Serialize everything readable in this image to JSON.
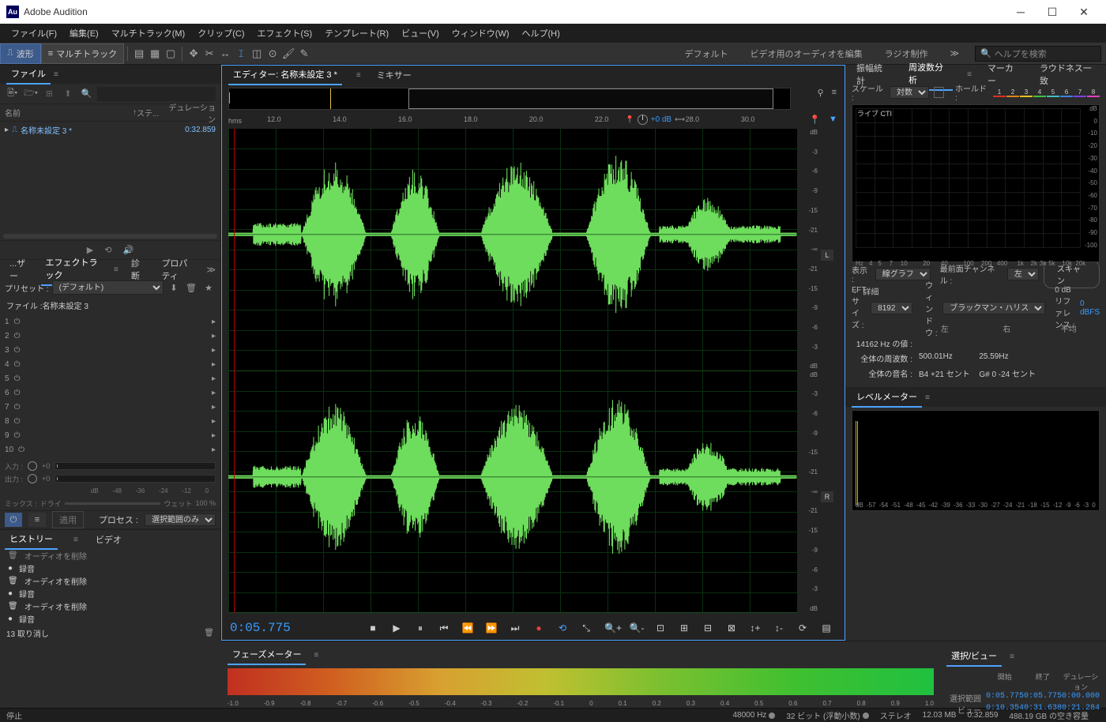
{
  "app": {
    "title": "Adobe Audition"
  },
  "menu": [
    "ファイル(F)",
    "編集(E)",
    "マルチトラック(M)",
    "クリップ(C)",
    "エフェクト(S)",
    "テンプレート(R)",
    "ビュー(V)",
    "ウィンドウ(W)",
    "ヘルプ(H)"
  ],
  "toolbar": {
    "waveform": "波形",
    "multitrack": "マルチトラック"
  },
  "workspaces": [
    "デフォルト",
    "ビデオ用のオーディオを編集",
    "ラジオ制作"
  ],
  "search_placeholder": "ヘルプを検索",
  "files": {
    "title": "ファイル",
    "cols": {
      "name": "名前",
      "status": "ステ...",
      "duration": "デュレーション"
    },
    "items": [
      {
        "name": "名称未設定 3 *",
        "duration": "0:32.859"
      }
    ]
  },
  "effects_rack": {
    "tabs": [
      "...ザー",
      "エフェクトラック",
      "診断",
      "プロパティ"
    ],
    "preset_label": "プリセット :",
    "preset_value": "(デフォルト)",
    "file_label": "ファイル :名称未設定 3",
    "slot_count": 10,
    "input_label": "入力 :",
    "output_label": "出力 :",
    "gain": "+0",
    "scale": [
      "dB",
      "-48",
      "-36",
      "-24",
      "-12",
      "0"
    ],
    "mix_label": "ミックス :",
    "dry": "ドライ",
    "wet": "ウェット",
    "wet_pct": "100 %",
    "apply": "適用",
    "process_label": "プロセス :",
    "process_value": "選択範囲のみ"
  },
  "history": {
    "tabs": [
      "ヒストリー",
      "ビデオ"
    ],
    "items": [
      {
        "label": "オーディオを削除",
        "icon": "trash",
        "dim": true
      },
      {
        "label": "録音",
        "icon": "rec"
      },
      {
        "label": "オーディオを削除",
        "icon": "trash"
      },
      {
        "label": "録音",
        "icon": "rec"
      },
      {
        "label": "オーディオを削除",
        "icon": "trash"
      },
      {
        "label": "録音",
        "icon": "rec"
      }
    ],
    "undo_count": "13 取り消し"
  },
  "editor": {
    "tabs": [
      "エディター: 名称未設定 3 *",
      "ミキサー"
    ],
    "timeline_unit": "hms",
    "timeline": [
      "12.0",
      "14.0",
      "16.0",
      "18.0",
      "20.0",
      "22.0",
      "28.0",
      "30.0"
    ],
    "volume_db": "+0 dB",
    "db_scale": [
      "dB",
      "-3",
      "-6",
      "-9",
      "-15",
      "-21",
      "-∞",
      "-21",
      "-15",
      "-9",
      "-6",
      "-3",
      "dB"
    ],
    "channels": [
      "L",
      "R"
    ],
    "timecode": "0:05.775"
  },
  "phase": {
    "title": "フェーズメーター",
    "scale": [
      "-1.0",
      "-0.9",
      "-0.8",
      "-0.7",
      "-0.6",
      "-0.5",
      "-0.4",
      "-0.3",
      "-0.2",
      "-0.1",
      "0",
      "0.1",
      "0.2",
      "0.3",
      "0.4",
      "0.5",
      "0.6",
      "0.7",
      "0.8",
      "0.9",
      "1.0"
    ]
  },
  "freq": {
    "tabs": [
      "振幅統計",
      "周波数分析",
      "マーカー",
      "ラウドネス一致"
    ],
    "scale_label": "スケール :",
    "scale_value": "対数",
    "hold_label": "ホールド :",
    "hold_colors": [
      "#e03020",
      "#e08020",
      "#e0c020",
      "#40c040",
      "#40c0c0",
      "#4080e0",
      "#8040e0",
      "#e040c0"
    ],
    "live": "ライブ CTI",
    "db_scale": [
      "dB",
      "0",
      "-10",
      "-20",
      "-30",
      "-40",
      "-50",
      "-60",
      "-70",
      "-80",
      "-90",
      "-100"
    ],
    "hz_scale": [
      {
        "v": "Hz",
        "p": 0
      },
      {
        "v": "4",
        "p": 6
      },
      {
        "v": "5",
        "p": 10
      },
      {
        "v": "7",
        "p": 15
      },
      {
        "v": "10",
        "p": 20
      },
      {
        "v": "20",
        "p": 30
      },
      {
        "v": "40",
        "p": 38
      },
      {
        "v": "100",
        "p": 48
      },
      {
        "v": "200",
        "p": 56
      },
      {
        "v": "400",
        "p": 63
      },
      {
        "v": "1k",
        "p": 72
      },
      {
        "v": "2k",
        "p": 78
      },
      {
        "v": "3k",
        "p": 82
      },
      {
        "v": "5k",
        "p": 86
      },
      {
        "v": "10k",
        "p": 92
      },
      {
        "v": "20k",
        "p": 98
      }
    ],
    "display_label": "表示 :",
    "display_value": "線グラフ",
    "topch_label": "最前面チャンネル :",
    "topch_value": "左",
    "scan_btn": "スキャン",
    "detail": "詳細",
    "fft_label": "FFT サイズ :",
    "fft_value": "8192",
    "window_label": "ウィンドウ :",
    "window_value": "ブラックマン・ハリス",
    "ref_label": "0 dB リファレンス :",
    "ref_value": "0 dBFS",
    "data": {
      "col_l": "左",
      "col_r": "右",
      "col_avg": "平均",
      "peak_label": "14162 Hz の値 :",
      "overall_label": "全体の周波数 :",
      "overall_l": "500.01Hz",
      "overall_r": "25.59Hz",
      "note_label": "全体の音名 :",
      "note_l": "B4 +21 セント",
      "note_r": "G# 0 -24 セント"
    }
  },
  "level": {
    "title": "レベルメーター",
    "scale": [
      "dB",
      "-57",
      "-54",
      "-51",
      "-48",
      "-45",
      "-42",
      "-39",
      "-36",
      "-33",
      "-30",
      "-27",
      "-24",
      "-21",
      "-18",
      "-15",
      "-12",
      "-9",
      "-6",
      "-3",
      "0"
    ]
  },
  "selection": {
    "title": "選択/ビュー",
    "cols": [
      "開始",
      "終了",
      "デュレーション"
    ],
    "rows": [
      {
        "label": "選択範囲",
        "start": "0:05.775",
        "end": "0:05.775",
        "dur": "0:00.000"
      },
      {
        "label": "ビュー",
        "start": "0:10.354",
        "end": "0:31.638",
        "dur": "0:21.284"
      }
    ]
  },
  "status": {
    "stopped": "停止",
    "sr": "48000 Hz",
    "bits": "32 ビット (浮動小数)",
    "ch": "ステレオ",
    "size": "12.03 MB",
    "dur": "0:32.859",
    "space": "488.19 GB の空き容量"
  }
}
